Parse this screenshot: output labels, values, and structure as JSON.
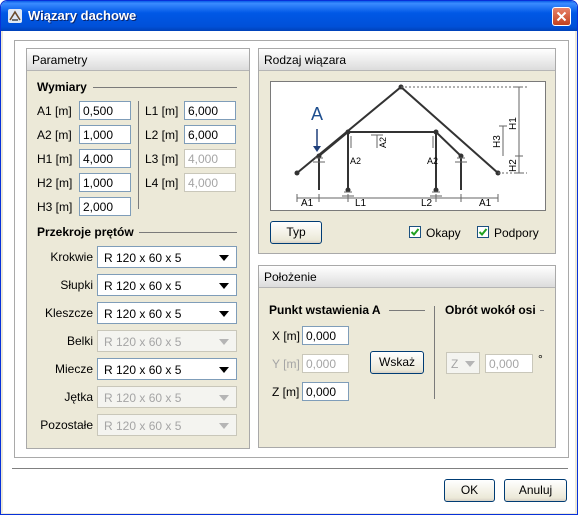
{
  "window": {
    "title": "Wiązary dachowe",
    "accent": "#0058e6"
  },
  "parametry": {
    "title": "Parametry",
    "wymiary_title": "Wymiary",
    "fields_left": [
      {
        "label": "A1 [m]",
        "value": "0,500"
      },
      {
        "label": "A2 [m]",
        "value": "1,000"
      },
      {
        "label": "H1 [m]",
        "value": "4,000"
      },
      {
        "label": "H2 [m]",
        "value": "1,000"
      },
      {
        "label": "H3 [m]",
        "value": "2,000"
      }
    ],
    "fields_right": [
      {
        "label": "L1 [m]",
        "value": "6,000",
        "enabled": true
      },
      {
        "label": "L2 [m]",
        "value": "6,000",
        "enabled": true
      },
      {
        "label": "L3 [m]",
        "value": "4,000",
        "enabled": false
      },
      {
        "label": "L4 [m]",
        "value": "4,000",
        "enabled": false
      }
    ],
    "przekroje_title": "Przekroje prętów",
    "sections": [
      {
        "label": "Krokwie",
        "value": "R 120 x 60 x 5",
        "enabled": true
      },
      {
        "label": "Słupki",
        "value": "R 120 x 60 x 5",
        "enabled": true
      },
      {
        "label": "Kleszcze",
        "value": "R 120 x 60 x 5",
        "enabled": true
      },
      {
        "label": "Belki",
        "value": "R 120 x 60 x 5",
        "enabled": false
      },
      {
        "label": "Miecze",
        "value": "R 120 x 60 x 5",
        "enabled": true
      },
      {
        "label": "Jętka",
        "value": "R 120 x 60 x 5",
        "enabled": false
      },
      {
        "label": "Pozostałe",
        "value": "R 120 x 60 x 5",
        "enabled": false
      }
    ]
  },
  "rodzaj": {
    "title": "Rodzaj wiązara",
    "diagram_labels": {
      "a": "A",
      "a1": "A1",
      "a2": "A2",
      "l1": "L1",
      "l2": "L2",
      "h1": "H1",
      "h2": "H2",
      "h3": "H3"
    },
    "typ_button": "Typ",
    "okapy": {
      "label": "Okapy",
      "checked": true
    },
    "podpory": {
      "label": "Podpory",
      "checked": true
    }
  },
  "polozenie": {
    "title": "Położenie",
    "punkt_title": "Punkt wstawienia A",
    "x": {
      "label": "X [m]",
      "value": "0,000"
    },
    "y": {
      "label": "Y [m]",
      "value": "0,000"
    },
    "z": {
      "label": "Z [m]",
      "value": "0,000"
    },
    "wskaz_button": "Wskaż",
    "obrot_title": "Obrót wokół osi",
    "axis_value": "Z",
    "angle_value": "0,000",
    "degree_symbol": "°"
  },
  "footer": {
    "ok": "OK",
    "cancel": "Anuluj"
  }
}
